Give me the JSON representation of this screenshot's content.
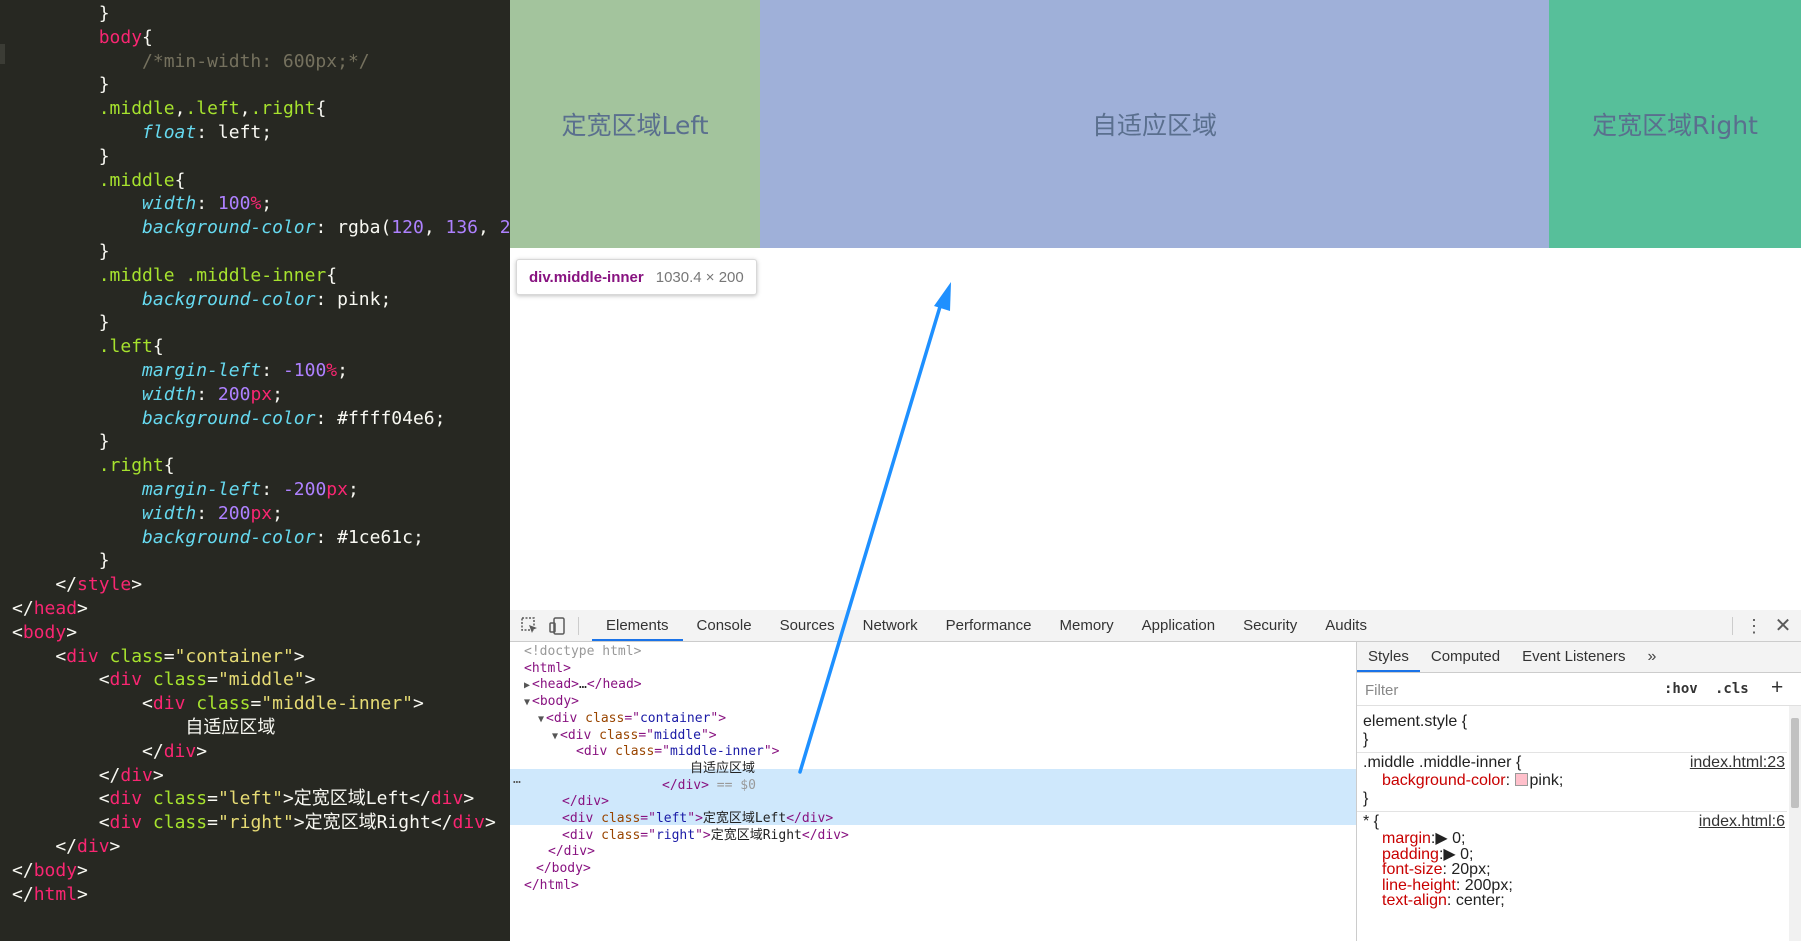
{
  "editor": {
    "lines": [
      [
        [
          "t-txt",
          "        }"
        ]
      ],
      [
        [
          "t-tag",
          "        body"
        ],
        [
          "t-txt",
          "{"
        ]
      ],
      [
        [
          "t-com",
          "            /*min-width: 600px;*/"
        ]
      ],
      [
        [
          "t-txt",
          "        }"
        ]
      ],
      [
        [
          "t-sel",
          "        .middle"
        ],
        [
          "t-txt",
          ","
        ],
        [
          "t-sel",
          ".left"
        ],
        [
          "t-txt",
          ","
        ],
        [
          "t-sel",
          ".right"
        ],
        [
          "t-txt",
          "{"
        ]
      ],
      [
        [
          "t-prop",
          "            float"
        ],
        [
          "t-txt",
          ": "
        ],
        [
          "t-txt",
          "left"
        ],
        [
          "t-txt",
          ";"
        ]
      ],
      [
        [
          "t-txt",
          "        }"
        ]
      ],
      [
        [
          "t-sel",
          "        .middle"
        ],
        [
          "t-txt",
          "{"
        ]
      ],
      [
        [
          "t-prop",
          "            width"
        ],
        [
          "t-txt",
          ": "
        ],
        [
          "t-num",
          "100"
        ],
        [
          "t-unit",
          "%"
        ],
        [
          "t-txt",
          ";"
        ]
      ],
      [
        [
          "t-prop",
          "            background-color"
        ],
        [
          "t-txt",
          ": rgba("
        ],
        [
          "t-num",
          "120"
        ],
        [
          "t-txt",
          ", "
        ],
        [
          "t-num",
          "136"
        ],
        [
          "t-txt",
          ", "
        ],
        [
          "t-num",
          "2"
        ]
      ],
      [
        [
          "t-txt",
          "        }"
        ]
      ],
      [
        [
          "t-sel",
          "        .middle .middle-inner"
        ],
        [
          "t-txt",
          "{"
        ]
      ],
      [
        [
          "t-prop",
          "            background-color"
        ],
        [
          "t-txt",
          ": pink;"
        ]
      ],
      [
        [
          "t-txt",
          "        }"
        ]
      ],
      [
        [
          "t-sel",
          "        .left"
        ],
        [
          "t-txt",
          "{"
        ]
      ],
      [
        [
          "t-prop",
          "            margin-left"
        ],
        [
          "t-txt",
          ": "
        ],
        [
          "t-num",
          "-100"
        ],
        [
          "t-unit",
          "%"
        ],
        [
          "t-txt",
          ";"
        ]
      ],
      [
        [
          "t-prop",
          "            width"
        ],
        [
          "t-txt",
          ": "
        ],
        [
          "t-num",
          "200"
        ],
        [
          "t-unit",
          "px"
        ],
        [
          "t-txt",
          ";"
        ]
      ],
      [
        [
          "t-prop",
          "            background-color"
        ],
        [
          "t-txt",
          ": #ffff04e6;"
        ]
      ],
      [
        [
          "t-txt",
          "        }"
        ]
      ],
      [
        [
          "t-sel",
          "        .right"
        ],
        [
          "t-txt",
          "{"
        ]
      ],
      [
        [
          "t-prop",
          "            margin-left"
        ],
        [
          "t-txt",
          ": "
        ],
        [
          "t-num",
          "-200"
        ],
        [
          "t-unit",
          "px"
        ],
        [
          "t-txt",
          ";"
        ]
      ],
      [
        [
          "t-prop",
          "            width"
        ],
        [
          "t-txt",
          ": "
        ],
        [
          "t-num",
          "200"
        ],
        [
          "t-unit",
          "px"
        ],
        [
          "t-txt",
          ";"
        ]
      ],
      [
        [
          "t-prop",
          "            background-color"
        ],
        [
          "t-txt",
          ": #1ce61c;"
        ]
      ],
      [
        [
          "t-txt",
          "        }"
        ]
      ],
      [
        [
          "t-txt",
          "    </"
        ],
        [
          "t-tag",
          "style"
        ],
        [
          "t-txt",
          ">"
        ]
      ],
      [
        [
          "t-txt",
          "</"
        ],
        [
          "t-tag",
          "head"
        ],
        [
          "t-txt",
          ">"
        ]
      ],
      [
        [
          "t-txt",
          "<"
        ],
        [
          "t-tag",
          "body"
        ],
        [
          "t-txt",
          ">"
        ]
      ],
      [
        [
          "t-txt",
          "    <"
        ],
        [
          "t-tag",
          "div"
        ],
        [
          "t-txt",
          " "
        ],
        [
          "t-attr",
          "class"
        ],
        [
          "t-txt",
          "="
        ],
        [
          "t-str",
          "\"container\""
        ],
        [
          "t-txt",
          ">"
        ]
      ],
      [
        [
          "t-txt",
          "        <"
        ],
        [
          "t-tag",
          "div"
        ],
        [
          "t-txt",
          " "
        ],
        [
          "t-attr",
          "class"
        ],
        [
          "t-txt",
          "="
        ],
        [
          "t-str",
          "\"middle\""
        ],
        [
          "t-txt",
          ">"
        ]
      ],
      [
        [
          "t-txt",
          "            <"
        ],
        [
          "t-tag",
          "div"
        ],
        [
          "t-txt",
          " "
        ],
        [
          "t-attr",
          "class"
        ],
        [
          "t-txt",
          "="
        ],
        [
          "t-str",
          "\"middle-inner\""
        ],
        [
          "t-txt",
          ">"
        ]
      ],
      [
        [
          "t-txt",
          "                自适应区域"
        ]
      ],
      [
        [
          "t-txt",
          "            </"
        ],
        [
          "t-tag",
          "div"
        ],
        [
          "t-txt",
          ">"
        ]
      ],
      [
        [
          "t-txt",
          "        </"
        ],
        [
          "t-tag",
          "div"
        ],
        [
          "t-txt",
          ">"
        ]
      ],
      [
        [
          "t-txt",
          "        <"
        ],
        [
          "t-tag",
          "div"
        ],
        [
          "t-txt",
          " "
        ],
        [
          "t-attr",
          "class"
        ],
        [
          "t-txt",
          "="
        ],
        [
          "t-str",
          "\"left\""
        ],
        [
          "t-txt",
          ">定宽区域Left</"
        ],
        [
          "t-tag",
          "div"
        ],
        [
          "t-txt",
          ">"
        ]
      ],
      [
        [
          "t-txt",
          "        <"
        ],
        [
          "t-tag",
          "div"
        ],
        [
          "t-txt",
          " "
        ],
        [
          "t-attr",
          "class"
        ],
        [
          "t-txt",
          "="
        ],
        [
          "t-str",
          "\"right\""
        ],
        [
          "t-txt",
          ">定宽区域Right</"
        ],
        [
          "t-tag",
          "div"
        ],
        [
          "t-txt",
          ">"
        ]
      ],
      [
        [
          "t-txt",
          "    </"
        ],
        [
          "t-tag",
          "div"
        ],
        [
          "t-txt",
          ">"
        ]
      ],
      [
        [
          "t-txt",
          "</"
        ],
        [
          "t-tag",
          "body"
        ],
        [
          "t-txt",
          ">"
        ]
      ],
      [
        [
          "t-txt",
          "</"
        ],
        [
          "t-tag",
          "html"
        ],
        [
          "t-txt",
          ">"
        ]
      ]
    ]
  },
  "viewport": {
    "left_label": "定宽区域Left",
    "middle_label": "自适应区域",
    "right_label": "定宽区域Right",
    "tooltip": {
      "name": "div.middle-inner",
      "size": "1030.4 × 200"
    },
    "colors": {
      "left": "#a3c49d",
      "middle": "#9fb0d9",
      "right": "#57bf9a"
    }
  },
  "devtools": {
    "tabs": [
      "Elements",
      "Console",
      "Sources",
      "Network",
      "Performance",
      "Memory",
      "Application",
      "Security",
      "Audits"
    ],
    "active_tab": "Elements",
    "elements": [
      [
        [
          "d-gray",
          "<!doctype html>"
        ]
      ],
      [
        [
          "d-tag",
          "<html>"
        ]
      ],
      [
        [
          "d-tri",
          "▶"
        ],
        [
          "d-tag",
          "<head>"
        ],
        [
          "d-txt",
          "…"
        ],
        [
          "d-tag",
          "</head>"
        ]
      ],
      [
        [
          "d-tri",
          "▼"
        ],
        [
          "d-tag",
          "<body>"
        ]
      ],
      [
        [
          "d-tri",
          "▼"
        ],
        [
          "d-tag",
          "<div "
        ],
        [
          "d-attr",
          "class"
        ],
        [
          "d-tag",
          "=\""
        ],
        [
          "d-val",
          "container"
        ],
        [
          "d-tag",
          "\">"
        ]
      ],
      [
        [
          "d-tri",
          "▼"
        ],
        [
          "d-tag",
          "<div "
        ],
        [
          "d-attr",
          "class"
        ],
        [
          "d-tag",
          "=\""
        ],
        [
          "d-val",
          "middle"
        ],
        [
          "d-tag",
          "\">"
        ]
      ],
      [
        [
          "d-tag",
          "<div "
        ],
        [
          "d-attr",
          "class"
        ],
        [
          "d-tag",
          "=\""
        ],
        [
          "d-val",
          "middle-inner"
        ],
        [
          "d-tag",
          "\">"
        ]
      ],
      [
        [
          "d-txt",
          "自适应区域"
        ]
      ],
      [
        [
          "d-tag",
          "</div>"
        ],
        [
          "d-gray",
          " == $0"
        ]
      ],
      [
        [
          "d-tag",
          "</div>"
        ]
      ],
      [
        [
          "d-tag",
          "<div "
        ],
        [
          "d-attr",
          "class"
        ],
        [
          "d-tag",
          "=\""
        ],
        [
          "d-val",
          "left"
        ],
        [
          "d-tag",
          "\">"
        ],
        [
          "d-txt",
          "定宽区域Left"
        ],
        [
          "d-tag",
          "</div>"
        ]
      ],
      [
        [
          "d-tag",
          "<div "
        ],
        [
          "d-attr",
          "class"
        ],
        [
          "d-tag",
          "=\""
        ],
        [
          "d-val",
          "right"
        ],
        [
          "d-tag",
          "\">"
        ],
        [
          "d-txt",
          "定宽区域Right"
        ],
        [
          "d-tag",
          "</div>"
        ]
      ],
      [
        [
          "d-tag",
          "</div>"
        ]
      ],
      [
        [
          "d-tag",
          "</body>"
        ]
      ],
      [
        [
          "d-tag",
          "</html>"
        ]
      ]
    ],
    "dots": "…",
    "styles": {
      "tabs": [
        "Styles",
        "Computed",
        "Event Listeners"
      ],
      "active_tab": "Styles",
      "more": "»",
      "filter_placeholder": "Filter",
      "hov": ":hov",
      "cls": ".cls",
      "plus": "+",
      "element_style": "element.style {",
      "close_brace": "}",
      "rule1_selector": ".middle .middle-inner {",
      "rule1_source": "index.html:23",
      "rule1_prop": "background-color",
      "rule1_value": "pink;",
      "rule2_selector": "* {",
      "rule2_source": "index.html:6",
      "rule2_props": [
        {
          "name": "margin",
          "value": "▶ 0;"
        },
        {
          "name": "padding",
          "value": "▶ 0;"
        },
        {
          "name": "font-size",
          "value": " 20px;"
        },
        {
          "name": "line-height",
          "value": " 200px;"
        },
        {
          "name": "text-align",
          "value": " center;"
        }
      ]
    }
  }
}
